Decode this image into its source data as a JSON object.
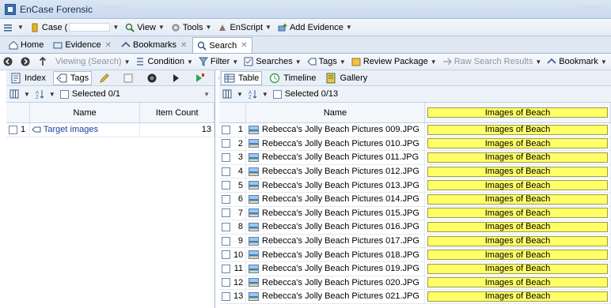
{
  "app": {
    "title": "EnCase Forensic"
  },
  "menubar": {
    "items": [
      {
        "label": "Case (",
        "icon": "case-icon"
      },
      {
        "label": "View",
        "icon": "view-icon"
      },
      {
        "label": "Tools",
        "icon": "tools-icon"
      },
      {
        "label": "EnScript",
        "icon": "enscript-icon"
      },
      {
        "label": "Add Evidence",
        "icon": "add-evidence-icon"
      }
    ]
  },
  "tabs": [
    {
      "label": "Home"
    },
    {
      "label": "Evidence"
    },
    {
      "label": "Bookmarks"
    },
    {
      "label": "Search"
    }
  ],
  "toolbar": {
    "viewing": "Viewing (Search)",
    "condition": "Condition",
    "filter": "Filter",
    "searches": "Searches",
    "tags": "Tags",
    "review_package": "Review Package",
    "raw_search_results": "Raw Search Results",
    "bookmark": "Bookmark"
  },
  "left": {
    "subtabs": {
      "index": "Index",
      "tags": "Tags"
    },
    "selected": "Selected 0/1",
    "columns": {
      "name": "Name",
      "item_count": "Item Count"
    },
    "rows": [
      {
        "num": "1",
        "name": "Target images",
        "count": "13"
      }
    ]
  },
  "right": {
    "subtabs": {
      "table": "Table",
      "timeline": "Timeline",
      "gallery": "Gallery"
    },
    "selected": "Selected 0/13",
    "columns": {
      "name": "Name",
      "tag": "Images of Beach"
    },
    "rows": [
      {
        "num": "1",
        "name": "Rebecca's Jolly Beach Pictures 009.JPG",
        "tag": "Images of Beach"
      },
      {
        "num": "2",
        "name": "Rebecca's Jolly Beach Pictures 010.JPG",
        "tag": "Images of Beach"
      },
      {
        "num": "3",
        "name": "Rebecca's Jolly Beach Pictures 011.JPG",
        "tag": "Images of Beach"
      },
      {
        "num": "4",
        "name": "Rebecca's Jolly Beach Pictures 012.JPG",
        "tag": "Images of Beach"
      },
      {
        "num": "5",
        "name": "Rebecca's Jolly Beach Pictures 013.JPG",
        "tag": "Images of Beach"
      },
      {
        "num": "6",
        "name": "Rebecca's Jolly Beach Pictures 014.JPG",
        "tag": "Images of Beach"
      },
      {
        "num": "7",
        "name": "Rebecca's Jolly Beach Pictures 015.JPG",
        "tag": "Images of Beach"
      },
      {
        "num": "8",
        "name": "Rebecca's Jolly Beach Pictures 016.JPG",
        "tag": "Images of Beach"
      },
      {
        "num": "9",
        "name": "Rebecca's Jolly Beach Pictures 017.JPG",
        "tag": "Images of Beach"
      },
      {
        "num": "10",
        "name": "Rebecca's Jolly Beach Pictures 018.JPG",
        "tag": "Images of Beach"
      },
      {
        "num": "11",
        "name": "Rebecca's Jolly Beach Pictures 019.JPG",
        "tag": "Images of Beach"
      },
      {
        "num": "12",
        "name": "Rebecca's Jolly Beach Pictures 020.JPG",
        "tag": "Images of Beach"
      },
      {
        "num": "13",
        "name": "Rebecca's Jolly Beach Pictures 021.JPG",
        "tag": "Images of Beach"
      }
    ]
  },
  "colors": {
    "tag_yellow": "#ffff66",
    "link_blue": "#1a3f9e"
  }
}
